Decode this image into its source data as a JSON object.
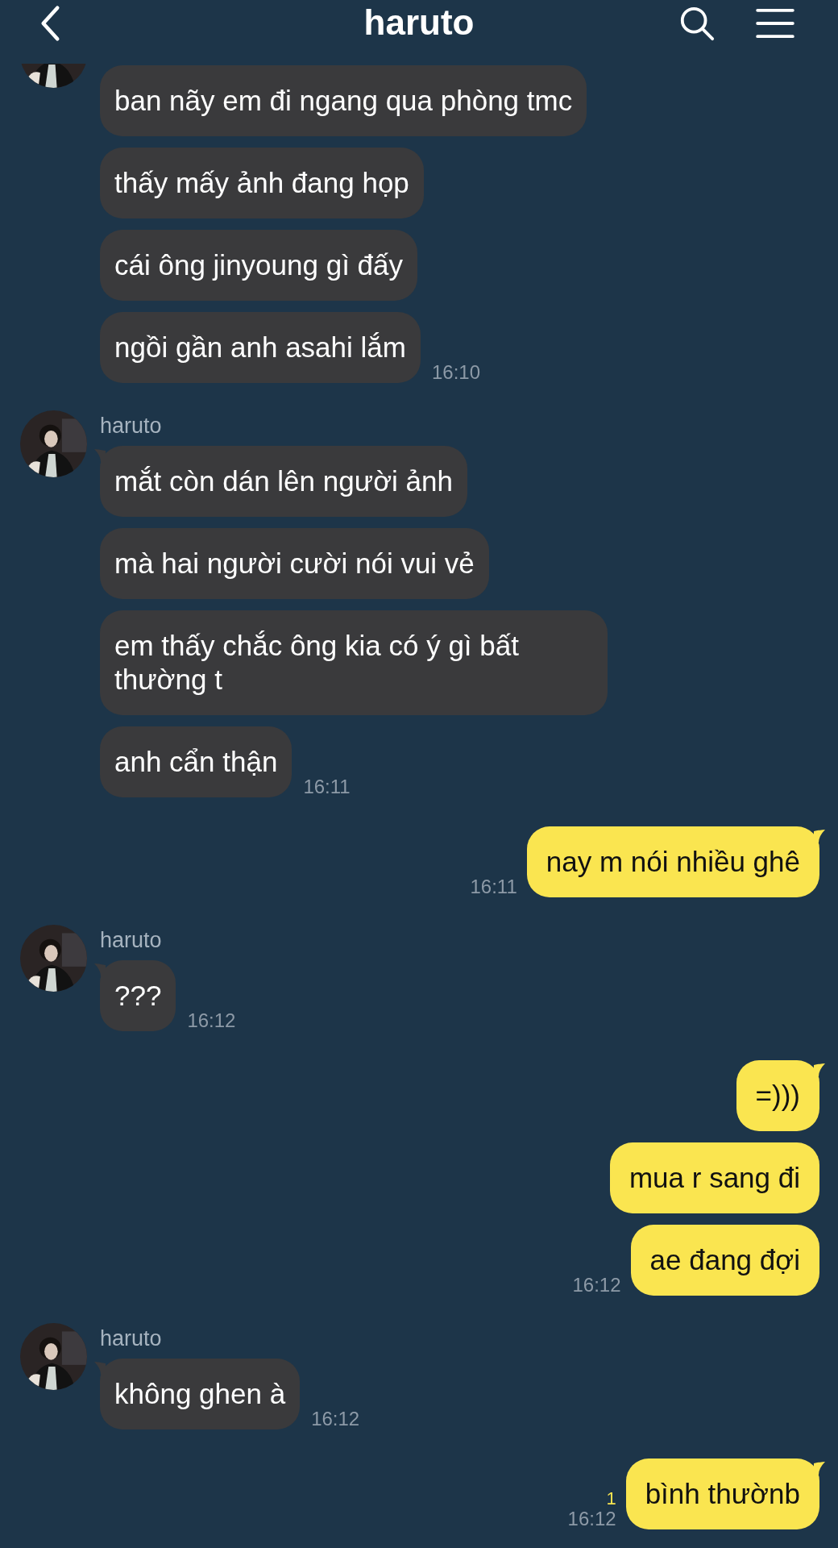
{
  "header": {
    "title": "haruto"
  },
  "messages": [
    {
      "kind": "incoming",
      "bubbles": [
        "ban nãy em đi ngang qua phòng tmc",
        "thấy mấy ảnh đang họp",
        "cái ông jinyoung gì đấy",
        "ngồi gần anh asahi lắm"
      ],
      "time": "16:10"
    },
    {
      "kind": "incoming",
      "sender": "haruto",
      "bubbles": [
        "mắt còn dán lên người ảnh",
        "mà hai người cười nói vui vẻ",
        "em thấy chắc ông kia có ý gì bất thường t",
        "anh cẩn thận"
      ],
      "time": "16:11"
    },
    {
      "kind": "outgoing",
      "bubbles": [
        "nay m nói nhiều ghê"
      ],
      "time": "16:11"
    },
    {
      "kind": "incoming",
      "sender": "haruto",
      "bubbles": [
        "???"
      ],
      "time": "16:12"
    },
    {
      "kind": "outgoing",
      "bubbles": [
        "=)))",
        "mua r sang đi",
        "ae đang đợi"
      ],
      "time": "16:12"
    },
    {
      "kind": "incoming",
      "sender": "haruto",
      "bubbles": [
        "không ghen à"
      ],
      "time": "16:12"
    },
    {
      "kind": "outgoing",
      "bubbles": [
        "bình thườnb"
      ],
      "time": "16:12",
      "unread": "1"
    }
  ]
}
